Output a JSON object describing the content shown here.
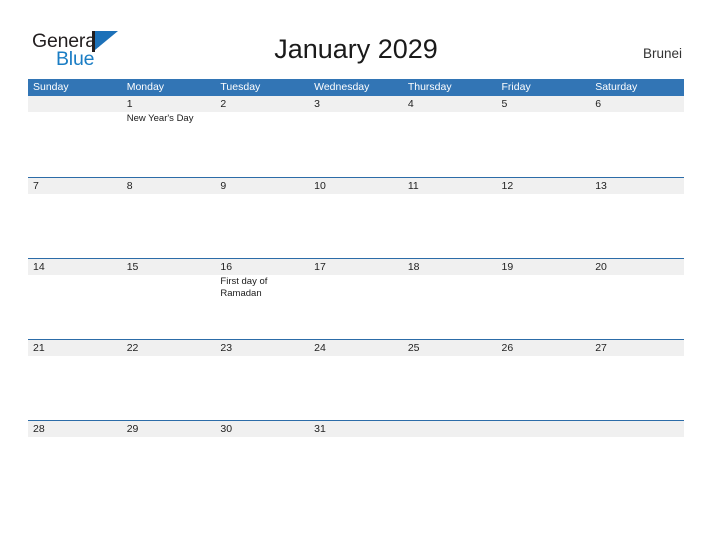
{
  "brand": {
    "name_top": "General",
    "name_bottom": "Blue",
    "mark": "flag-triangle-icon",
    "color_dark": "#231f20",
    "color_blue": "#1a7dc4"
  },
  "header": {
    "title": "January 2029",
    "region": "Brunei"
  },
  "theme": {
    "header_blue": "#3275b5",
    "row_divider_blue": "#2c6ca8",
    "band_gray": "#f0f0f0",
    "text_dark": "#222222"
  },
  "calendar": {
    "month": "January",
    "year": "2029",
    "weekdays": [
      "Sunday",
      "Monday",
      "Tuesday",
      "Wednesday",
      "Thursday",
      "Friday",
      "Saturday"
    ],
    "weeks": [
      [
        {
          "day": ""
        },
        {
          "day": "1",
          "events": [
            "New Year's Day"
          ]
        },
        {
          "day": "2"
        },
        {
          "day": "3"
        },
        {
          "day": "4"
        },
        {
          "day": "5"
        },
        {
          "day": "6"
        }
      ],
      [
        {
          "day": "7"
        },
        {
          "day": "8"
        },
        {
          "day": "9"
        },
        {
          "day": "10"
        },
        {
          "day": "11"
        },
        {
          "day": "12"
        },
        {
          "day": "13"
        }
      ],
      [
        {
          "day": "14"
        },
        {
          "day": "15"
        },
        {
          "day": "16",
          "events": [
            "First day of Ramadan"
          ]
        },
        {
          "day": "17"
        },
        {
          "day": "18"
        },
        {
          "day": "19"
        },
        {
          "day": "20"
        }
      ],
      [
        {
          "day": "21"
        },
        {
          "day": "22"
        },
        {
          "day": "23"
        },
        {
          "day": "24"
        },
        {
          "day": "25"
        },
        {
          "day": "26"
        },
        {
          "day": "27"
        }
      ],
      [
        {
          "day": "28"
        },
        {
          "day": "29"
        },
        {
          "day": "30"
        },
        {
          "day": "31"
        },
        {
          "day": ""
        },
        {
          "day": ""
        },
        {
          "day": ""
        }
      ]
    ]
  }
}
